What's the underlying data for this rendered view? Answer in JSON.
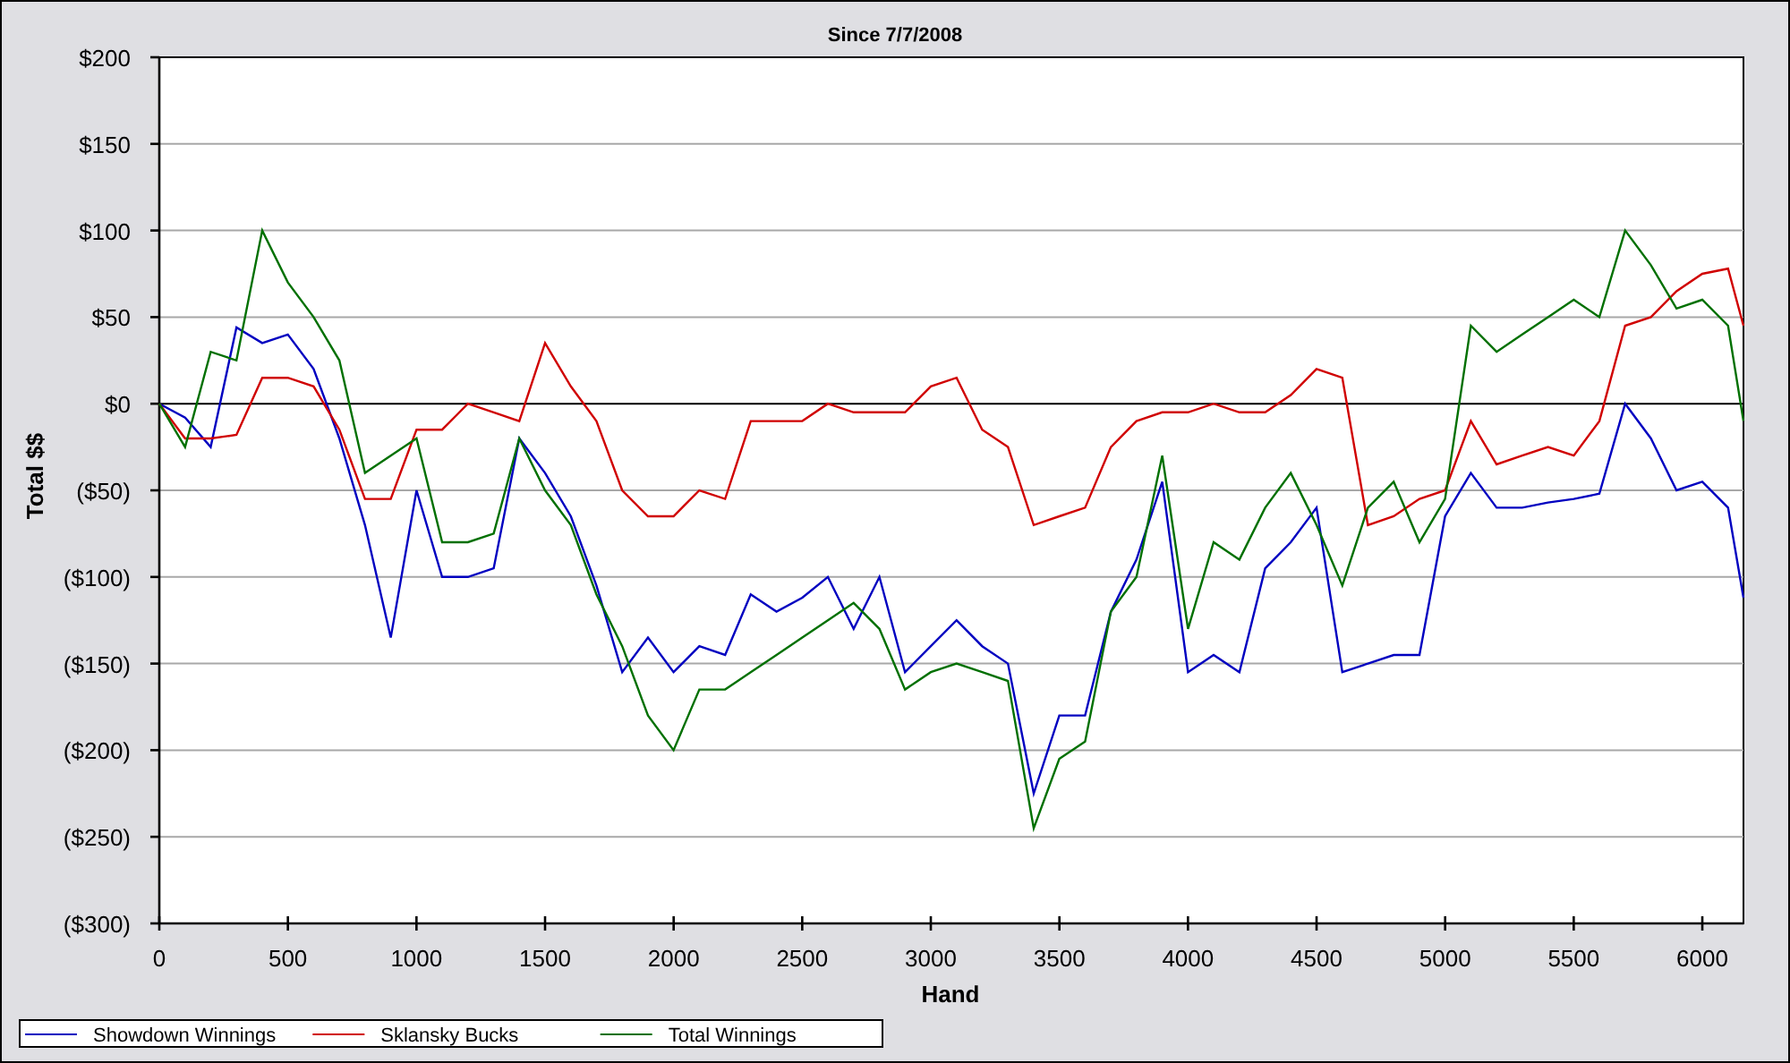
{
  "chart": {
    "chart_data": {
      "type": "line",
      "title": "Since 7/7/2008",
      "xlabel": "Hand",
      "ylabel": "Total $$",
      "x": [
        0,
        100,
        200,
        300,
        400,
        500,
        600,
        700,
        800,
        900,
        1000,
        1100,
        1200,
        1300,
        1400,
        1500,
        1600,
        1700,
        1800,
        1900,
        2000,
        2100,
        2200,
        2300,
        2400,
        2500,
        2600,
        2700,
        2800,
        2900,
        3000,
        3100,
        3200,
        3300,
        3400,
        3500,
        3600,
        3700,
        3800,
        3900,
        4000,
        4100,
        4200,
        4300,
        4400,
        4500,
        4600,
        4700,
        4800,
        4900,
        5000,
        5100,
        5200,
        5300,
        5400,
        5500,
        5600,
        5700,
        5800,
        5900,
        6000,
        6100,
        6160
      ],
      "series": [
        {
          "name": "Showdown Winnings",
          "color": "#0000c0",
          "values": [
            0,
            -8,
            -25,
            44,
            35,
            40,
            20,
            -20,
            -70,
            -135,
            -50,
            -100,
            -100,
            -95,
            -20,
            -40,
            -65,
            -105,
            -155,
            -135,
            -155,
            -140,
            -145,
            -110,
            -120,
            -112,
            -100,
            -130,
            -100,
            -155,
            -140,
            -125,
            -140,
            -150,
            -225,
            -180,
            -180,
            -120,
            -90,
            -45,
            -155,
            -145,
            -155,
            -95,
            -80,
            -60,
            -155,
            -150,
            -145,
            -145,
            -65,
            -40,
            -60,
            -60,
            -57,
            -55,
            -52,
            0,
            -20,
            -50,
            -45,
            -60,
            -112
          ]
        },
        {
          "name": "Sklansky Bucks",
          "color": "#d00000",
          "values": [
            0,
            -20,
            -20,
            -18,
            15,
            15,
            10,
            -15,
            -55,
            -55,
            -15,
            -15,
            0,
            -5,
            -10,
            35,
            10,
            -10,
            -50,
            -65,
            -65,
            -50,
            -55,
            -10,
            -10,
            -10,
            0,
            -5,
            -5,
            -5,
            10,
            15,
            -15,
            -25,
            -70,
            -65,
            -60,
            -25,
            -10,
            -5,
            -5,
            0,
            -5,
            -5,
            5,
            20,
            15,
            -70,
            -65,
            -55,
            -50,
            -10,
            -35,
            -30,
            -25,
            -30,
            -10,
            45,
            50,
            65,
            75,
            78,
            45
          ]
        },
        {
          "name": "Total Winnings",
          "color": "#007000",
          "values": [
            0,
            -25,
            30,
            25,
            100,
            70,
            50,
            25,
            -40,
            -30,
            -20,
            -80,
            -80,
            -75,
            -20,
            -50,
            -70,
            -110,
            -140,
            -180,
            -200,
            -165,
            -165,
            -155,
            -145,
            -135,
            -125,
            -115,
            -130,
            -165,
            -155,
            -150,
            -155,
            -160,
            -245,
            -205,
            -195,
            -120,
            -100,
            -30,
            -130,
            -80,
            -90,
            -60,
            -40,
            -70,
            -105,
            -60,
            -45,
            -80,
            -55,
            45,
            30,
            40,
            50,
            60,
            50,
            100,
            80,
            55,
            60,
            45,
            -10
          ]
        }
      ],
      "grid": true,
      "legend": "bottom",
      "xlim": [
        0,
        6160
      ],
      "ylim": [
        -300,
        200
      ],
      "xticks": [
        0,
        500,
        1000,
        1500,
        2000,
        2500,
        3000,
        3500,
        4000,
        4500,
        5000,
        5500,
        6000
      ],
      "yticks": [
        {
          "value": 200,
          "label": "$200"
        },
        {
          "value": 150,
          "label": "$150"
        },
        {
          "value": 100,
          "label": "$100"
        },
        {
          "value": 50,
          "label": "$50"
        },
        {
          "value": 0,
          "label": "$0"
        },
        {
          "value": -50,
          "label": "($50)"
        },
        {
          "value": -100,
          "label": "($100)"
        },
        {
          "value": -150,
          "label": "($150)"
        },
        {
          "value": -200,
          "label": "($200)"
        },
        {
          "value": -250,
          "label": "($250)"
        },
        {
          "value": -300,
          "label": "($300)"
        }
      ]
    }
  }
}
